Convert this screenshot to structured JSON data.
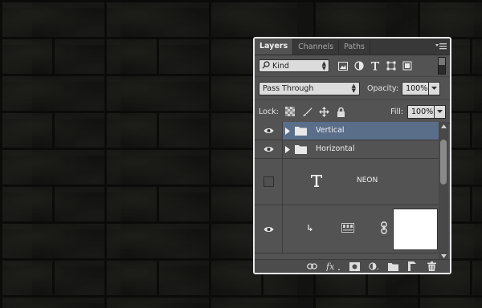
{
  "panel": {
    "tabs": [
      {
        "label": "Layers",
        "active": true
      },
      {
        "label": "Channels",
        "active": false
      },
      {
        "label": "Paths",
        "active": false
      }
    ]
  },
  "filter": {
    "kind_value": "Kind",
    "filter_icons": [
      "image-filter-icon",
      "adjustment-filter-icon",
      "type-filter-icon",
      "shape-filter-icon",
      "smart-object-filter-icon"
    ]
  },
  "blend": {
    "mode": "Pass Through",
    "opacity_label": "Opacity:",
    "opacity_value": "100%"
  },
  "lock": {
    "label": "Lock:",
    "fill_label": "Fill:",
    "fill_value": "100%"
  },
  "layers": [
    {
      "name": "Vertical",
      "type": "group",
      "visible": true,
      "selected": true
    },
    {
      "name": "Horizontal",
      "type": "group",
      "visible": true,
      "selected": false
    },
    {
      "name": "NEON",
      "type": "text",
      "visible": false,
      "selected": false
    },
    {
      "name": "",
      "type": "adjustment-with-mask",
      "visible": true,
      "selected": false
    }
  ],
  "colors": {
    "panel_bg": "#535353",
    "selected_layer": "#5a6e8a",
    "tab_bar": "#383838"
  }
}
